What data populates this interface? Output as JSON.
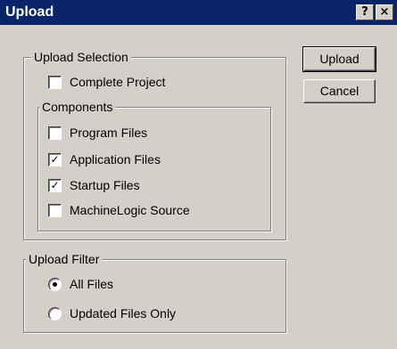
{
  "window": {
    "title": "Upload",
    "help_label": "?",
    "close_label": "×"
  },
  "upload_selection": {
    "legend": "Upload Selection",
    "complete_project": {
      "label": "Complete Project",
      "checked": false
    },
    "components": {
      "legend": "Components",
      "items": [
        {
          "label": "Program Files",
          "checked": false
        },
        {
          "label": "Application Files",
          "checked": true
        },
        {
          "label": "Startup Files",
          "checked": true
        },
        {
          "label": "MachineLogic Source",
          "checked": false
        }
      ]
    }
  },
  "upload_filter": {
    "legend": "Upload Filter",
    "options": [
      {
        "label": "All Files",
        "selected": true
      },
      {
        "label": "Updated Files Only",
        "selected": false
      }
    ]
  },
  "buttons": {
    "upload": "Upload",
    "cancel": "Cancel"
  },
  "check_glyph": "✓"
}
